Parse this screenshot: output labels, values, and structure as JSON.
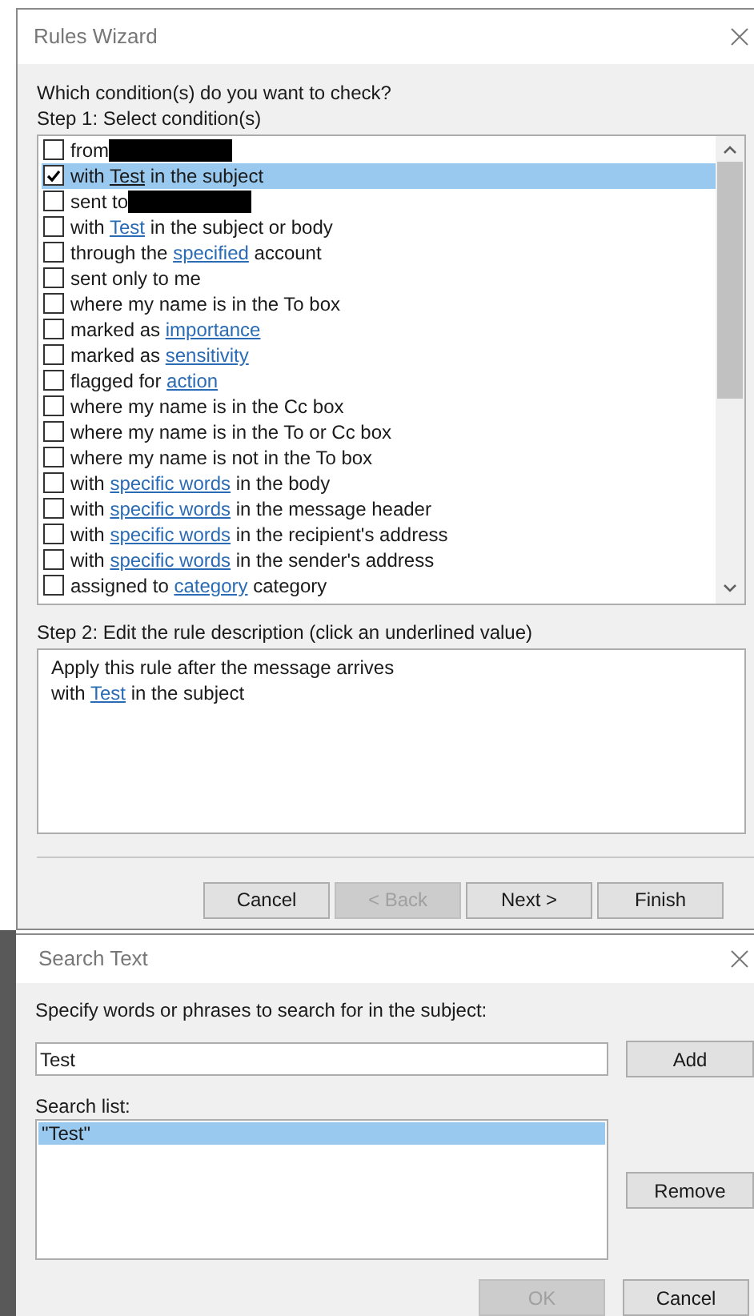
{
  "rules_wizard": {
    "title": "Rules Wizard",
    "question": "Which condition(s) do you want to check?",
    "step1_label": "Step 1: Select condition(s)",
    "conditions": [
      {
        "checked": false,
        "selected": false,
        "redacted": true,
        "parts": [
          {
            "text": "from"
          }
        ]
      },
      {
        "checked": true,
        "selected": true,
        "redacted": false,
        "parts": [
          {
            "text": "with "
          },
          {
            "text": "Test",
            "link": true
          },
          {
            "text": " in the subject"
          }
        ]
      },
      {
        "checked": false,
        "selected": false,
        "redacted": true,
        "parts": [
          {
            "text": "sent to"
          }
        ]
      },
      {
        "checked": false,
        "selected": false,
        "redacted": false,
        "parts": [
          {
            "text": "with "
          },
          {
            "text": "Test",
            "link": true
          },
          {
            "text": " in the subject or body"
          }
        ]
      },
      {
        "checked": false,
        "selected": false,
        "redacted": false,
        "parts": [
          {
            "text": "through the "
          },
          {
            "text": "specified",
            "link": true
          },
          {
            "text": " account"
          }
        ]
      },
      {
        "checked": false,
        "selected": false,
        "redacted": false,
        "parts": [
          {
            "text": "sent only to me"
          }
        ]
      },
      {
        "checked": false,
        "selected": false,
        "redacted": false,
        "parts": [
          {
            "text": "where my name is in the To box"
          }
        ]
      },
      {
        "checked": false,
        "selected": false,
        "redacted": false,
        "parts": [
          {
            "text": "marked as "
          },
          {
            "text": "importance",
            "link": true
          }
        ]
      },
      {
        "checked": false,
        "selected": false,
        "redacted": false,
        "parts": [
          {
            "text": "marked as "
          },
          {
            "text": "sensitivity",
            "link": true
          }
        ]
      },
      {
        "checked": false,
        "selected": false,
        "redacted": false,
        "parts": [
          {
            "text": "flagged for "
          },
          {
            "text": "action",
            "link": true
          }
        ]
      },
      {
        "checked": false,
        "selected": false,
        "redacted": false,
        "parts": [
          {
            "text": "where my name is in the Cc box"
          }
        ]
      },
      {
        "checked": false,
        "selected": false,
        "redacted": false,
        "parts": [
          {
            "text": "where my name is in the To or Cc box"
          }
        ]
      },
      {
        "checked": false,
        "selected": false,
        "redacted": false,
        "parts": [
          {
            "text": "where my name is not in the To box"
          }
        ]
      },
      {
        "checked": false,
        "selected": false,
        "redacted": false,
        "parts": [
          {
            "text": "with "
          },
          {
            "text": "specific words",
            "link": true
          },
          {
            "text": " in the body"
          }
        ]
      },
      {
        "checked": false,
        "selected": false,
        "redacted": false,
        "parts": [
          {
            "text": "with "
          },
          {
            "text": "specific words",
            "link": true
          },
          {
            "text": " in the message header"
          }
        ]
      },
      {
        "checked": false,
        "selected": false,
        "redacted": false,
        "parts": [
          {
            "text": "with "
          },
          {
            "text": "specific words",
            "link": true
          },
          {
            "text": " in the recipient's address"
          }
        ]
      },
      {
        "checked": false,
        "selected": false,
        "redacted": false,
        "parts": [
          {
            "text": "with "
          },
          {
            "text": "specific words",
            "link": true
          },
          {
            "text": " in the sender's address"
          }
        ]
      },
      {
        "checked": false,
        "selected": false,
        "redacted": false,
        "parts": [
          {
            "text": "assigned to "
          },
          {
            "text": "category",
            "link": true
          },
          {
            "text": " category"
          }
        ]
      }
    ],
    "step2_label": "Step 2: Edit the rule description (click an underlined value)",
    "description": [
      [
        {
          "text": "Apply this rule after the message arrives"
        }
      ],
      [
        {
          "text": "with "
        },
        {
          "text": "Test",
          "link": true
        },
        {
          "text": " in the subject"
        }
      ]
    ],
    "buttons": [
      {
        "label": "Cancel",
        "disabled": false
      },
      {
        "label": "< Back",
        "disabled": true
      },
      {
        "label": "Next >",
        "disabled": false
      },
      {
        "label": "Finish",
        "disabled": false
      }
    ]
  },
  "search_text": {
    "title": "Search Text",
    "prompt": "Specify words or phrases to search for in the subject:",
    "input_value": "Test",
    "add_button": "Add",
    "list_label": "Search list:",
    "items": [
      {
        "text": "\"Test\"",
        "selected": true
      }
    ],
    "remove_button": "Remove",
    "buttons": [
      {
        "label": "OK",
        "disabled": true
      },
      {
        "label": "Cancel",
        "disabled": false
      }
    ]
  }
}
